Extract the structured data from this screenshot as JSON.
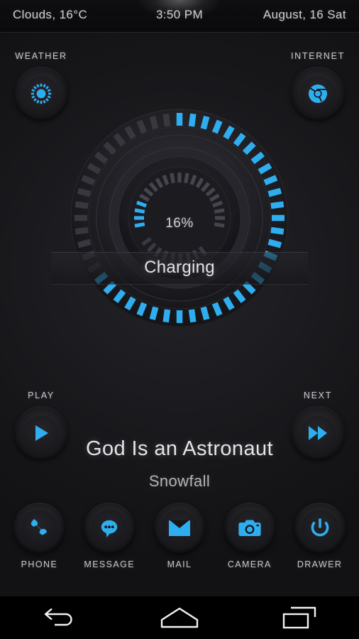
{
  "status_bar": {
    "weather": "Clouds, 16°C",
    "clock": "3:50 PM",
    "date": "August, 16 Sat"
  },
  "shortcuts": {
    "weather": {
      "label": "WEATHER",
      "icon": "sun-icon"
    },
    "internet": {
      "label": "INTERNET",
      "icon": "chrome-icon"
    }
  },
  "battery_widget": {
    "percent_label": "16%",
    "percent_value": 16,
    "status": "Charging",
    "outer_ring_ticks": 48,
    "outer_ring_filled": 32,
    "inner_ring_ticks": 21,
    "inner_ring_filled": 4
  },
  "media": {
    "play": {
      "label": "PLAY",
      "icon": "play-icon"
    },
    "next": {
      "label": "NEXT",
      "icon": "fast-forward-icon"
    },
    "artist": "God Is an Astronaut",
    "track": "Snowfall"
  },
  "dock": {
    "items": [
      {
        "label": "PHONE",
        "icon": "phone-icon"
      },
      {
        "label": "MESSAGE",
        "icon": "message-bubble-icon"
      },
      {
        "label": "MAIL",
        "icon": "envelope-icon"
      },
      {
        "label": "CAMERA",
        "icon": "camera-icon"
      },
      {
        "label": "DRAWER",
        "icon": "power-icon"
      }
    ]
  },
  "navigation": {
    "back": "back-arrow-icon",
    "home": "home-icon",
    "recents": "recents-icon"
  },
  "colors": {
    "accent": "#2FAEEF",
    "accent_dim": "#2B3A44",
    "background": "#161619",
    "text_primary": "#E2E2E7",
    "text_secondary": "#B3B3BA",
    "navbar": "#000000"
  }
}
